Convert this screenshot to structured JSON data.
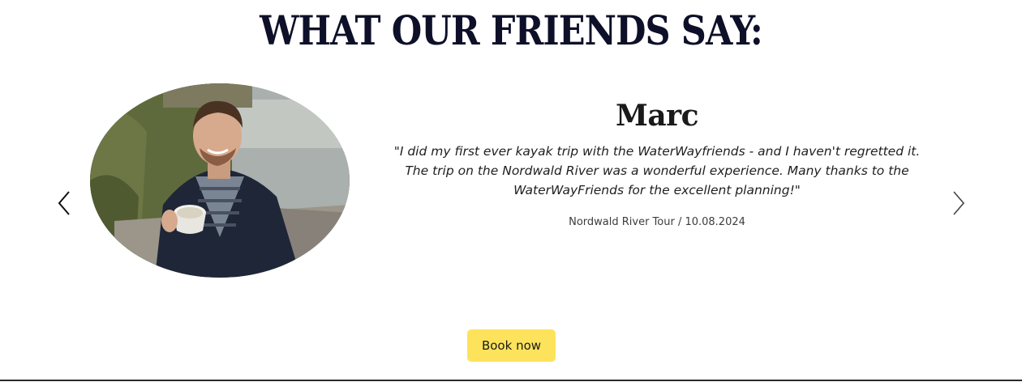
{
  "section": {
    "title": "WHAT OUR FRIENDS SAY:"
  },
  "carousel": {
    "prev_icon": "chevron-left-icon",
    "next_icon": "chevron-right-icon"
  },
  "testimonial": {
    "photo_icon": "testimonial-photo",
    "name": "Marc",
    "quote_line1": "\"I did my first ever kayak trip with the WaterWayfriends - and I haven't regretted it.",
    "quote_line2": "The trip on the Nordwald River was a wonderful experience. Many thanks to the",
    "quote_line3": "WaterWayFriends for the excellent planning!\"",
    "meta": "Nordwald River Tour / 10.08.2024"
  },
  "cta": {
    "book_label": "Book now",
    "button_color": "#fde35c"
  }
}
